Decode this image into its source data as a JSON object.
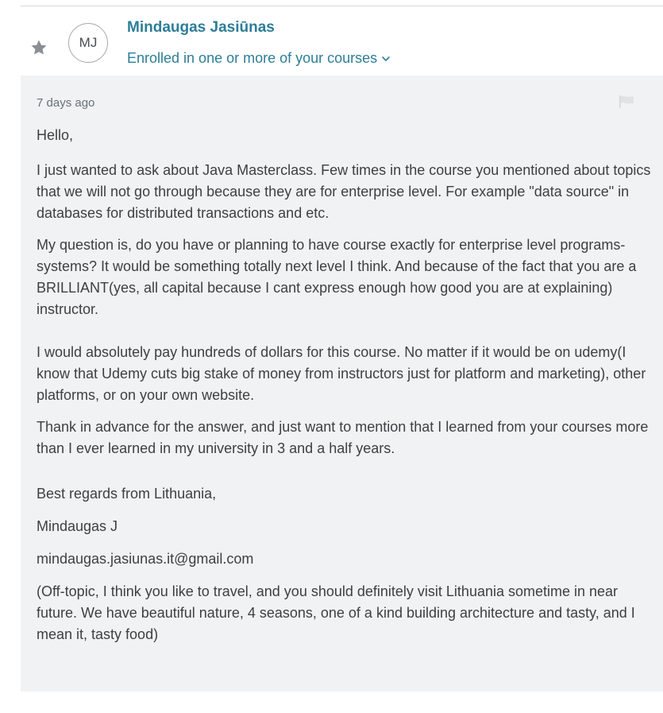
{
  "header": {
    "author_name": "Mindaugas Jasiūnas",
    "avatar_initials": "MJ",
    "enrollment": "Enrolled in one or more of your courses"
  },
  "message": {
    "timestamp": "7 days ago",
    "lines": {
      "greeting": "Hello,",
      "p1": "I just wanted to ask about Java Masterclass. Few times in the course you mentioned about topics that we will not go through because they are for enterprise level. For example \"data source\" in databases for distributed transactions and etc.",
      "p2": "My question is, do you have or planning to have course exactly for enterprise level programs-systems? It would be something totally next level I think. And because of the fact that you are a BRILLIANT(yes, all capital because I cant express enough how good you are at explaining) instructor.",
      "p3": "I would absolutely pay hundreds of dollars for this course. No matter if it would be on udemy(I know that Udemy cuts big stake of money from instructors just for platform and marketing), other platforms, or on your own website.",
      "p4": "Thank in advance for the answer, and just want to mention that I learned from your courses more than I ever learned in my university in 3 and a half years.",
      "signoff": "Best regards from Lithuania,",
      "signature": "Mindaugas J",
      "email": "mindaugas.jasiunas.it@gmail.com",
      "p5": "(Off-topic, I think you like to travel, and you should definitely visit Lithuania sometime in near future. We have beautiful nature, 4 seasons, one of a kind building architecture and tasty, and I mean it, tasty food)"
    }
  },
  "icons": {
    "star": "star-icon",
    "flag": "flag-icon",
    "chevron": "chevron-down-icon"
  },
  "colors": {
    "accent": "#2d7e97",
    "message_bg": "#f1f2f3",
    "text": "#3e3f42",
    "muted": "#686f7a"
  }
}
